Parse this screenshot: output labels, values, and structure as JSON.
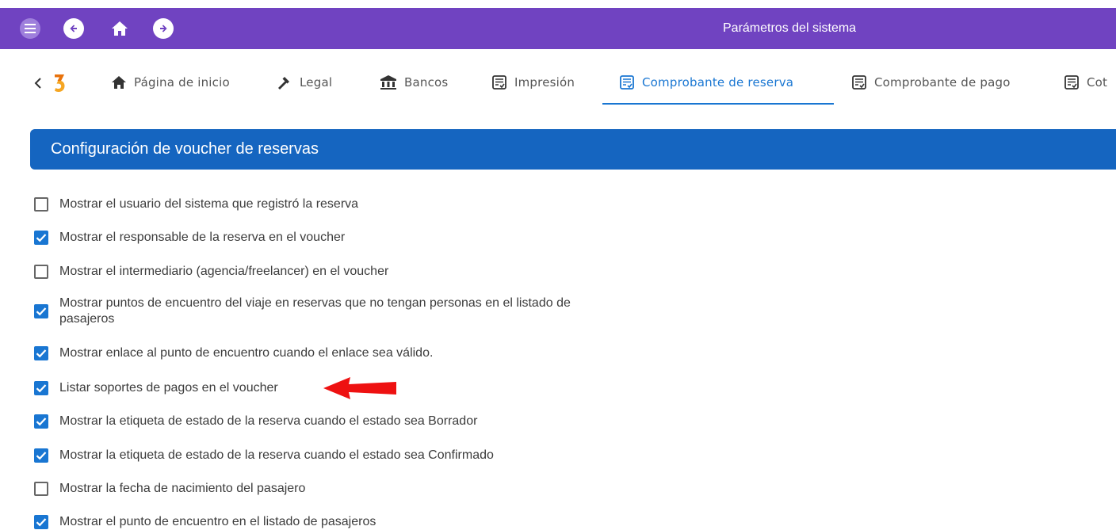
{
  "app": {
    "title": "Parámetros del sistema",
    "accent_color": "#7043c1",
    "primary_color": "#1976d2"
  },
  "topbar": {
    "menu_icon": "hamburger-menu-icon",
    "back_icon": "arrow-left-circle-icon",
    "home_icon": "home-icon",
    "forward_icon": "arrow-right-circle-icon"
  },
  "tabs": [
    {
      "label": "Página de inicio",
      "icon": "home-icon",
      "active": false
    },
    {
      "label": "Legal",
      "icon": "gavel-icon",
      "active": false
    },
    {
      "label": "Bancos",
      "icon": "bank-icon",
      "active": false
    },
    {
      "label": "Impresión",
      "icon": "document-check-icon",
      "active": false
    },
    {
      "label": "Comprobante de reserva",
      "icon": "document-check-icon",
      "active": true
    },
    {
      "label": "Comprobante de pago",
      "icon": "document-check-icon",
      "active": false
    },
    {
      "label": "Cot",
      "icon": "document-check-icon",
      "active": false
    }
  ],
  "section": {
    "title": "Configuración de voucher de reservas"
  },
  "options": [
    {
      "label": "Mostrar el usuario del sistema que registró la reserva",
      "checked": false
    },
    {
      "label": "Mostrar el responsable de la reserva en el voucher",
      "checked": true
    },
    {
      "label": "Mostrar el intermediario (agencia/freelancer) en el voucher",
      "checked": false
    },
    {
      "label": "Mostrar puntos de encuentro del viaje en reservas que no tengan personas en el listado de",
      "label2": "pasajeros",
      "checked": true
    },
    {
      "label": "Mostrar enlace al punto de encuentro cuando el enlace sea válido.",
      "checked": true
    },
    {
      "label": "Listar soportes de pagos en el voucher",
      "checked": true
    },
    {
      "label": "Mostrar la etiqueta de estado de la reserva cuando el estado sea Borrador",
      "checked": true
    },
    {
      "label": "Mostrar la etiqueta de estado de la reserva cuando el estado sea Confirmado",
      "checked": true
    },
    {
      "label": "Mostrar la fecha de nacimiento del pasajero",
      "checked": false
    },
    {
      "label": "Mostrar el punto de encuentro en el listado de pasajeros",
      "checked": true
    }
  ],
  "annotation": {
    "arrow_icon": "red-arrow-left-icon",
    "arrow_color": "#ee1111"
  }
}
